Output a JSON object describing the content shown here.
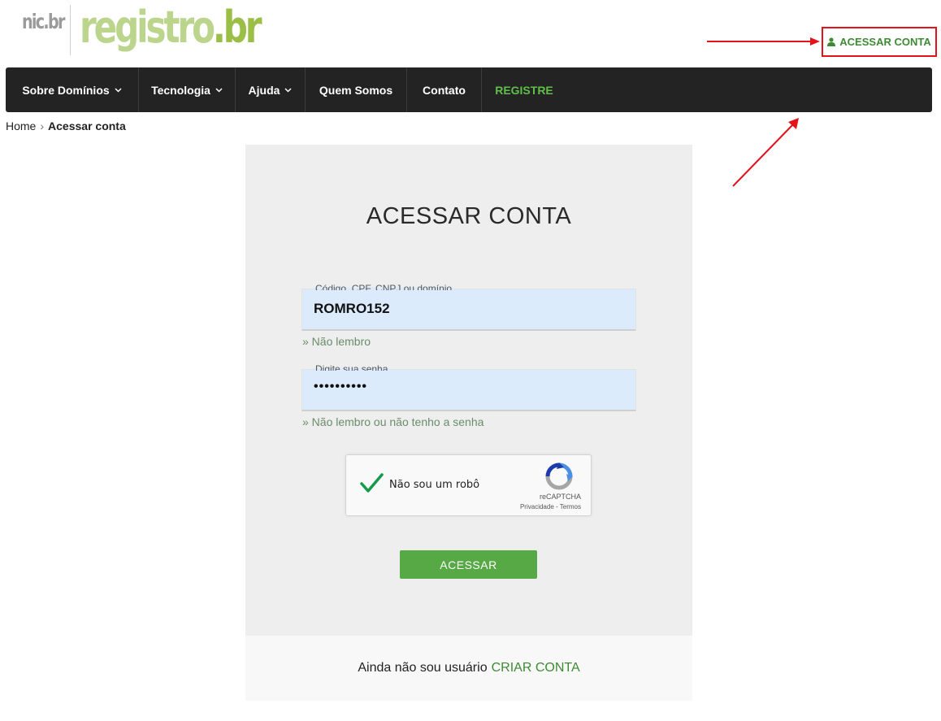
{
  "header": {
    "logo_nic": "nic.br",
    "logo_registro": "registro",
    "logo_tld": ".br",
    "login_label": "ACESSAR CONTA"
  },
  "nav": {
    "items": [
      {
        "label": "Sobre Domínios",
        "has_dropdown": true
      },
      {
        "label": "Tecnologia",
        "has_dropdown": true
      },
      {
        "label": "Ajuda",
        "has_dropdown": true
      },
      {
        "label": "Quem Somos",
        "has_dropdown": false
      },
      {
        "label": "Contato",
        "has_dropdown": false
      },
      {
        "label": "REGISTRE",
        "has_dropdown": false
      }
    ]
  },
  "breadcrumb": {
    "home": "Home",
    "separator": "›",
    "current": "Acessar conta"
  },
  "login_form": {
    "title": "ACESSAR CONTA",
    "user_field": {
      "label": "Código, CPF, CNPJ ou domínio",
      "value": "ROMRO152"
    },
    "forgot_user": "» Não lembro",
    "password_field": {
      "label": "Digite sua senha",
      "value": "••••••••••"
    },
    "forgot_password": "» Não lembro ou não tenho a senha",
    "captcha": {
      "label": "Não sou um robô",
      "brand": "reCAPTCHA",
      "privacy": "Privacidade",
      "terms_separator": "-",
      "terms": "Termos",
      "checked": true
    },
    "submit_label": "ACESSAR"
  },
  "signup": {
    "text": "Ainda não sou usuário",
    "link": "CRIAR CONTA"
  },
  "colors": {
    "accent_green": "#3e8a34",
    "button_green": "#56a945",
    "nav_bg": "#232323",
    "annotation_red": "#e3121b"
  }
}
